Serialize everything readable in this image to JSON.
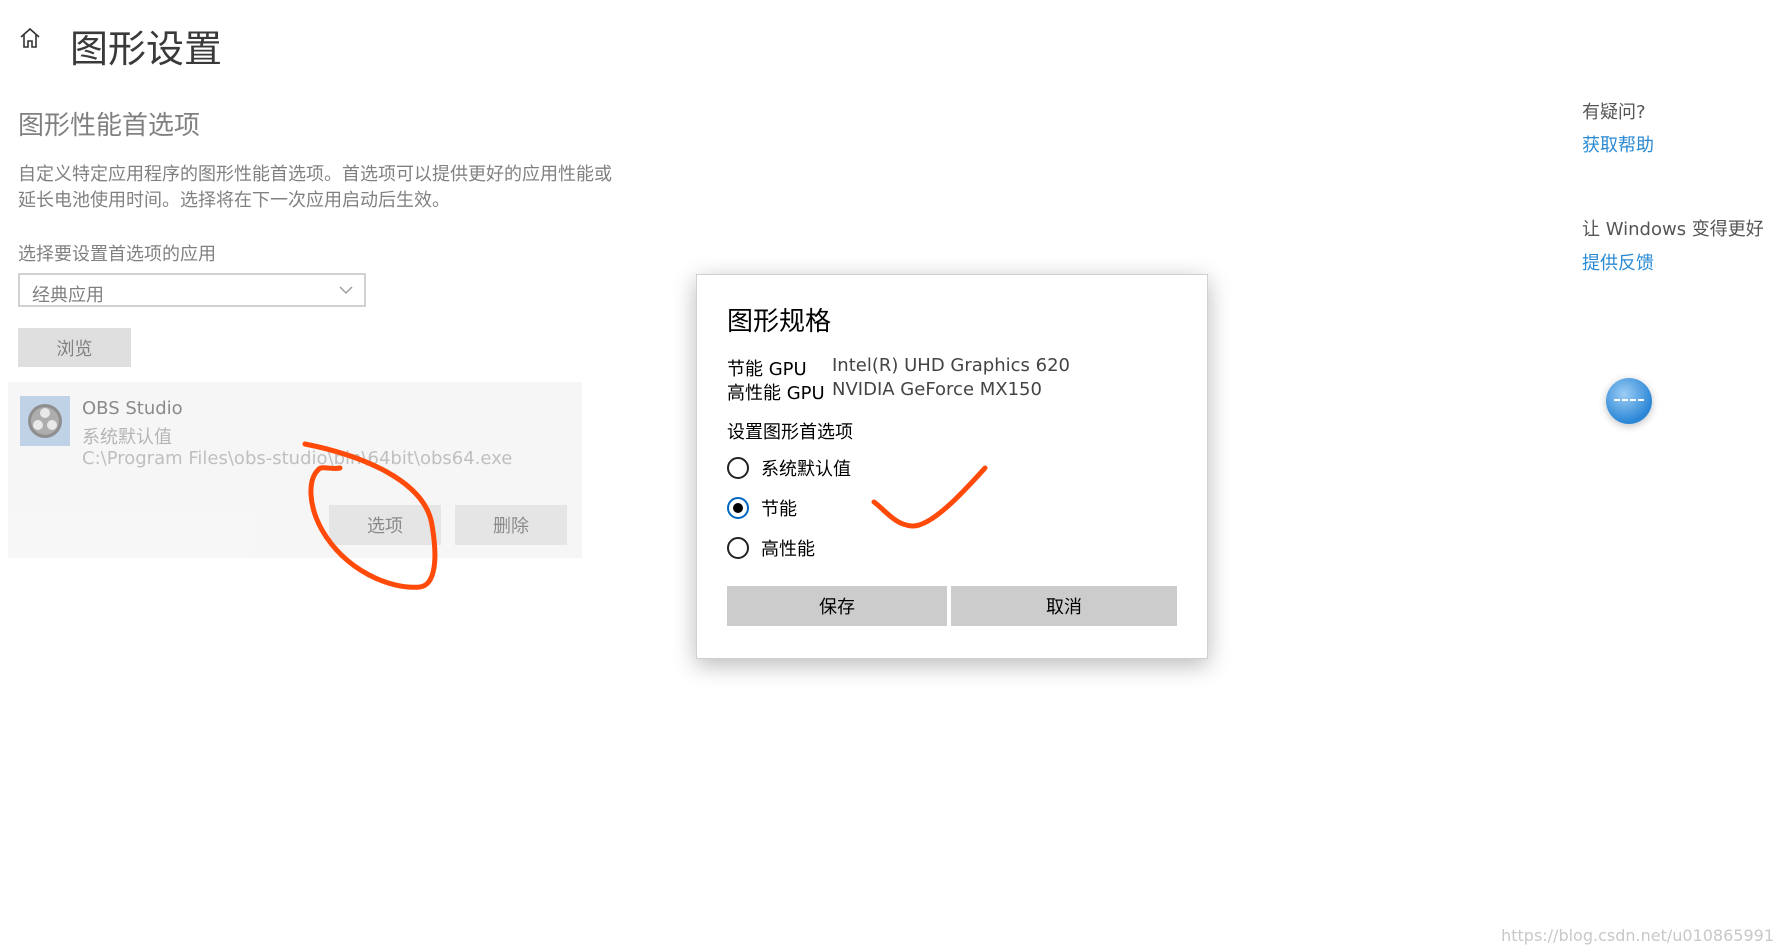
{
  "header": {
    "title": "图形设置",
    "home_icon": "home-icon"
  },
  "main": {
    "section_title": "图形性能首选项",
    "description": "自定义特定应用程序的图形性能首选项。首选项可以提供更好的应用性能或延长电池使用时间。选择将在下一次应用启动后生效。",
    "select_label": "选择要设置首选项的应用",
    "select_value": "经典应用",
    "browse_label": "浏览",
    "app": {
      "name": "OBS Studio",
      "setting": "系统默认值",
      "path": "C:\\Program Files\\obs-studio\\bin\\64bit\\obs64.exe",
      "options_label": "选项",
      "remove_label": "删除"
    }
  },
  "sidebar_right": {
    "question": "有疑问?",
    "help_link": "获取帮助",
    "improve": "让 Windows 变得更好",
    "feedback_link": "提供反馈"
  },
  "modal": {
    "title": "图形规格",
    "gpu_rows": [
      {
        "label": "节能 GPU",
        "value": "Intel(R) UHD Graphics 620"
      },
      {
        "label": "高性能 GPU",
        "value": "NVIDIA GeForce MX150"
      }
    ],
    "pref_label": "设置图形首选项",
    "options": [
      {
        "label": "系统默认值",
        "checked": false
      },
      {
        "label": "节能",
        "checked": true
      },
      {
        "label": "高性能",
        "checked": false
      }
    ],
    "save_label": "保存",
    "cancel_label": "取消"
  },
  "colors": {
    "accent": "#0067c0",
    "link": "#2a8ad4",
    "annotation": "#ff4a0a"
  },
  "watermark": "https://blog.csdn.net/u010865991"
}
